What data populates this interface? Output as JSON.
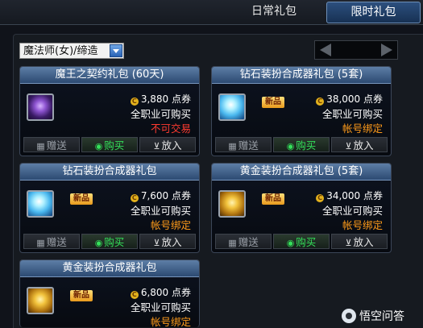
{
  "tabs": [
    {
      "label": "日常礼包",
      "active": false
    },
    {
      "label": "限时礼包",
      "active": true
    }
  ],
  "class_filter": {
    "value": "魔法师(女)/缔造"
  },
  "cards": [
    {
      "title": "魔王之契约礼包 (60天)",
      "icon": "purple-orb-icon",
      "badge": "",
      "price": "3,880 点券",
      "availability": "全职业可购买",
      "restriction": "不可交易",
      "restriction_color": "red"
    },
    {
      "title": "钻石装扮合成器礼包 (5套)",
      "icon": "diamond-icon",
      "badge": "新品",
      "price": "38,000 点券",
      "availability": "全职业可购买",
      "restriction": "帐号绑定",
      "restriction_color": "orange"
    },
    {
      "title": "钻石装扮合成器礼包",
      "icon": "diamond-icon",
      "badge": "新品",
      "price": "7,600 点券",
      "availability": "全职业可购买",
      "restriction": "帐号绑定",
      "restriction_color": "orange"
    },
    {
      "title": "黄金装扮合成器礼包 (5套)",
      "icon": "gold-box-icon",
      "badge": "新品",
      "price": "34,000 点券",
      "availability": "全职业可购买",
      "restriction": "帐号绑定",
      "restriction_color": "orange"
    },
    {
      "title": "黄金装扮合成器礼包",
      "icon": "gold-box-icon",
      "badge": "新品",
      "price": "6,800 点券",
      "availability": "全职业可购买",
      "restriction": "帐号绑定",
      "restriction_color": "orange"
    }
  ],
  "actions": {
    "gift": "赠送",
    "buy": "购买",
    "cart": "放入"
  },
  "currency_symbol": "C",
  "watermark": "悟空问答"
}
